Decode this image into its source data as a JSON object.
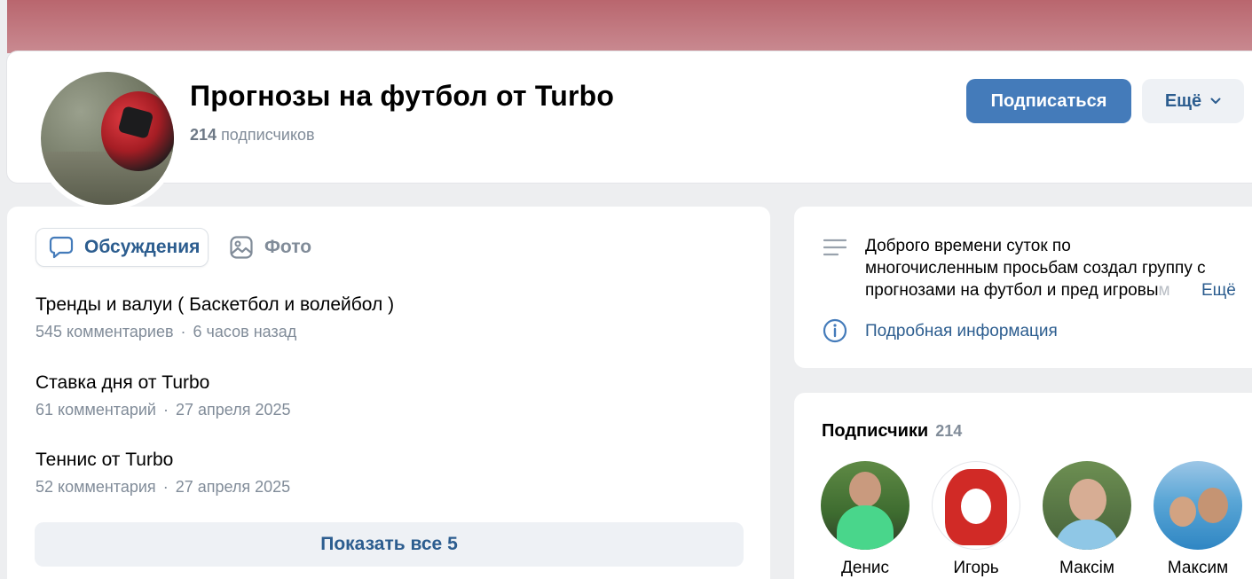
{
  "header": {
    "title": "Прогнозы на футбол от Turbo",
    "subscribers_count": "214",
    "subscribers_label": "подписчиков",
    "subscribe_button": "Подписаться",
    "more_button": "Ещё"
  },
  "tabs": {
    "discussions": "Обсуждения",
    "photos": "Фото"
  },
  "topics": [
    {
      "title": "Тренды и валуи ( Баскетбол и волейбол )",
      "comments": "545 комментариев",
      "sep": "·",
      "time": "6 часов назад"
    },
    {
      "title": "Ставка дня от Turbo",
      "comments": "61 комментарий",
      "sep": "·",
      "time": "27 апреля 2025"
    },
    {
      "title": "Теннис от Turbo",
      "comments": "52 комментария",
      "sep": "·",
      "time": "27 апреля 2025"
    }
  ],
  "show_all_button": "Показать все 5",
  "info": {
    "line1": "Доброго времени суток по",
    "line2": "многочисленным просьбам создал группу с",
    "line3_visible": "прогнозами на футбол и пред игровы",
    "line3_faded": "м",
    "more_link": "Ещё",
    "details_link": "Подробная информация"
  },
  "subscribers": {
    "heading": "Подписчики",
    "count": "214",
    "members": [
      {
        "name": "Денис"
      },
      {
        "name": "Игорь"
      },
      {
        "name": "Максім"
      },
      {
        "name": "Максим"
      }
    ]
  },
  "colors": {
    "accent": "#447bba",
    "link": "#2c5d8f",
    "secondary_text": "#818c99",
    "background": "#edeef0",
    "cover": "#c07880"
  }
}
